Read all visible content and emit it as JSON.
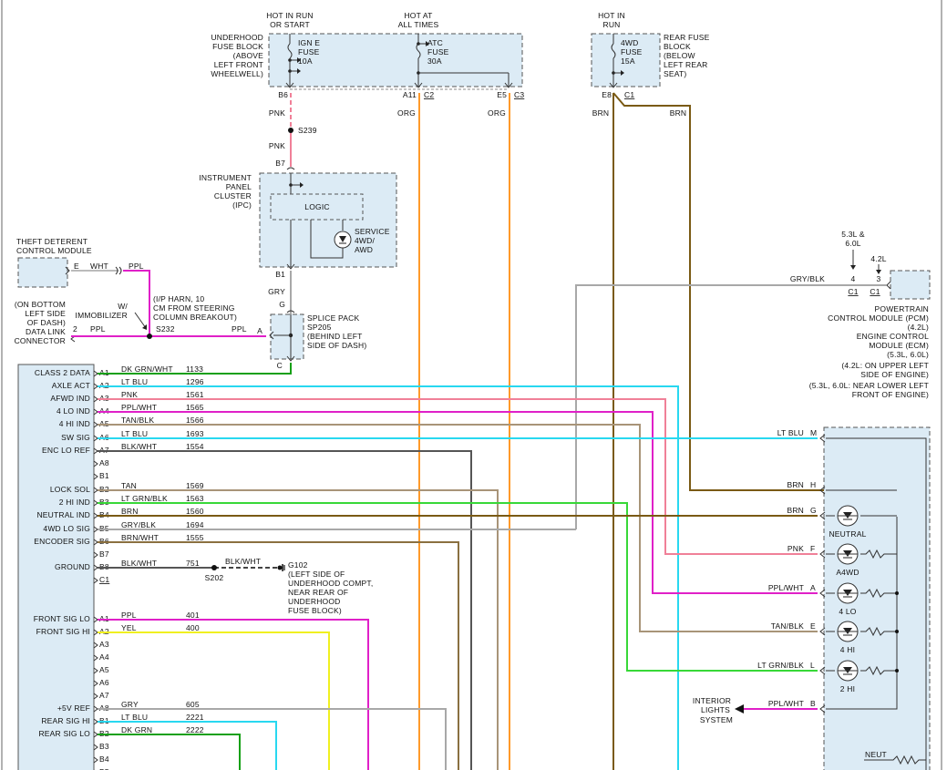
{
  "top": {
    "hot_run_start": [
      "HOT IN RUN",
      "OR START"
    ],
    "hot_all_times": [
      "HOT AT",
      "ALL TIMES"
    ],
    "hot_run": [
      "HOT IN",
      "RUN"
    ]
  },
  "underhood": {
    "label": [
      "UNDERHOOD",
      "FUSE BLOCK",
      "(ABOVE",
      "LEFT FRONT",
      "WHEELWELL)"
    ],
    "fuse1": [
      "IGN E",
      "FUSE",
      "10A"
    ],
    "fuse2": [
      "ATC",
      "FUSE",
      "30A"
    ],
    "pin_b6": "B6",
    "pin_a11": "A11",
    "pin_e5": "E5",
    "conn_c2": "C2",
    "conn_c3": "C3"
  },
  "rear_fuse": {
    "label": [
      "REAR FUSE",
      "BLOCK",
      "(BELOW",
      "LEFT REAR",
      "SEAT)"
    ],
    "fuse": [
      "4WD",
      "FUSE",
      "15A"
    ],
    "pin_e8": "E8",
    "conn_c1": "C1"
  },
  "wires": {
    "pnk1": "PNK",
    "pnk2": "PNK",
    "s239": "S239",
    "b7": "B7",
    "org1": "ORG",
    "org2": "ORG",
    "brn1": "BRN",
    "brn2": "BRN",
    "b1": "B1",
    "gry": "GRY",
    "g": "G",
    "c": "C",
    "a": "A"
  },
  "ipc": {
    "label": [
      "INSTRUMENT",
      "PANEL",
      "CLUSTER",
      "(IPC)"
    ],
    "logic": "LOGIC",
    "service": [
      "SERVICE",
      "4WD/",
      "AWD"
    ]
  },
  "theft": {
    "label": [
      "THEFT DETERENT",
      "CONTROL MODULE"
    ],
    "e": "E",
    "wht": "WHT",
    "ppl": "PPL"
  },
  "dlc": {
    "label": [
      "(ON BOTTOM",
      "LEFT SIDE",
      "OF DASH)",
      "DATA LINK",
      "CONNECTOR"
    ],
    "pin": "2",
    "wire": "PPL"
  },
  "immobilizer": {
    "label": [
      "W/",
      "IMMOBILIZER"
    ]
  },
  "ip_harn": [
    "(I/P HARN, 10",
    "CM FROM STEERING",
    "COLUMN BREAKOUT)"
  ],
  "s232": "S232",
  "ppl_s232": "PPL",
  "splice": {
    "label": [
      "SPLICE PACK",
      "SP205",
      "(BEHIND LEFT",
      "SIDE OF DASH)"
    ]
  },
  "pcm": {
    "variant_a": [
      "5.3L &",
      "6.0L"
    ],
    "variant_b": "4.2L",
    "pin4": "4",
    "pin3": "3",
    "c1a": "C1",
    "c1b": "C1",
    "gry_blk": "GRY/BLK",
    "label": [
      "POWERTRAIN",
      "CONTROL MODULE (PCM)",
      "(4.2L)",
      "ENGINE CONTROL",
      "MODULE (ECM)",
      "(5.3L, 6.0L)",
      "(4.2L: ON UPPER LEFT",
      "SIDE OF ENGINE)",
      "(5.3L, 6.0L: NEAR LOWER LEFT",
      "FRONT OF ENGINE)"
    ]
  },
  "tccm": {
    "rows": [
      {
        "pin": "A1",
        "wire": "DK GRN/WHT",
        "circuit": "1133",
        "label": "CLASS 2 DATA"
      },
      {
        "pin": "A2",
        "wire": "LT BLU",
        "circuit": "1296",
        "label": "AXLE ACT"
      },
      {
        "pin": "A3",
        "wire": "PNK",
        "circuit": "1561",
        "label": "AFWD IND"
      },
      {
        "pin": "A4",
        "wire": "PPL/WHT",
        "circuit": "1565",
        "label": "4 LO IND"
      },
      {
        "pin": "A5",
        "wire": "TAN/BLK",
        "circuit": "1566",
        "label": "4 HI IND"
      },
      {
        "pin": "A6",
        "wire": "LT BLU",
        "circuit": "1693",
        "label": "SW SIG"
      },
      {
        "pin": "A7",
        "wire": "BLK/WHT",
        "circuit": "1554",
        "label": "ENC LO REF"
      },
      {
        "pin": "A8",
        "wire": "",
        "circuit": "",
        "label": ""
      },
      {
        "pin": "B1",
        "wire": "",
        "circuit": "",
        "label": ""
      },
      {
        "pin": "B2",
        "wire": "TAN",
        "circuit": "1569",
        "label": "LOCK SOL"
      },
      {
        "pin": "B3",
        "wire": "LT GRN/BLK",
        "circuit": "1563",
        "label": "2 HI IND"
      },
      {
        "pin": "B4",
        "wire": "BRN",
        "circuit": "1560",
        "label": "NEUTRAL IND"
      },
      {
        "pin": "B5",
        "wire": "GRY/BLK",
        "circuit": "1694",
        "label": "4WD LO SIG"
      },
      {
        "pin": "B6",
        "wire": "BRN/WHT",
        "circuit": "1555",
        "label": "ENCODER SIG"
      },
      {
        "pin": "B7",
        "wire": "",
        "circuit": "",
        "label": ""
      },
      {
        "pin": "B8",
        "wire": "BLK/WHT",
        "circuit": "751",
        "label": ""
      },
      {
        "pin": "C1",
        "wire": "",
        "circuit": "",
        "label": ""
      },
      {
        "pin": "A1",
        "wire": "PPL",
        "circuit": "401",
        "label": ""
      },
      {
        "pin": "A2",
        "wire": "YEL",
        "circuit": "400",
        "label": ""
      },
      {
        "pin": "A3",
        "wire": "",
        "circuit": "",
        "label": ""
      },
      {
        "pin": "A4",
        "wire": "",
        "circuit": "",
        "label": ""
      },
      {
        "pin": "A5",
        "wire": "",
        "circuit": "",
        "label": ""
      },
      {
        "pin": "A6",
        "wire": "",
        "circuit": "",
        "label": ""
      },
      {
        "pin": "A7",
        "wire": "",
        "circuit": "",
        "label": ""
      },
      {
        "pin": "A8",
        "wire": "GRY",
        "circuit": "605",
        "label": ""
      },
      {
        "pin": "B1",
        "wire": "LT BLU",
        "circuit": "2221",
        "label": ""
      },
      {
        "pin": "B2",
        "wire": "DK GRN",
        "circuit": "2222",
        "label": ""
      },
      {
        "pin": "B3",
        "wire": "",
        "circuit": "",
        "label": ""
      },
      {
        "pin": "B4",
        "wire": "",
        "circuit": "",
        "label": ""
      },
      {
        "pin": "B5",
        "wire": "",
        "circuit": "",
        "label": ""
      }
    ],
    "ground_label": "GROUND",
    "front_sig_lo": "FRONT SIG LO",
    "front_sig_hi": "FRONT SIG HI",
    "ref_5v": "+5V REF",
    "rear_sig_hi": "REAR SIG HI",
    "rear_sig_lo": "REAR SIG LO",
    "s202": "S202",
    "blk_wht": "BLK/WHT",
    "g102": "G102",
    "g102_note": [
      "(LEFT SIDE OF",
      "UNDERHOOD COMPT,",
      "NEAR REAR OF",
      "UNDERHOOD",
      "FUSE BLOCK)"
    ]
  },
  "switch": {
    "rows": [
      {
        "wire": "LT BLU",
        "pin": "M"
      },
      {
        "wire": "BRN",
        "pin": "H"
      },
      {
        "wire": "BRN",
        "pin": "G"
      },
      {
        "wire": "PNK",
        "pin": "F"
      },
      {
        "wire": "PPL/WHT",
        "pin": "A"
      },
      {
        "wire": "TAN/BLK",
        "pin": "E"
      },
      {
        "wire": "LT GRN/BLK",
        "pin": "L"
      },
      {
        "wire": "PPL/WHT",
        "pin": "B"
      }
    ],
    "leds": [
      "NEUTRAL",
      "A4WD",
      "4 LO",
      "4 HI",
      "2 HI"
    ],
    "neut": "NEUT",
    "interior": [
      "INTERIOR",
      "LIGHTS",
      "SYSTEM"
    ]
  },
  "colors": {
    "pnk": "#f08098",
    "org": "#ff9a2a",
    "brn": "#7a5a14",
    "gry": "#a8a8a8",
    "ppl": "#e020c8",
    "ltblu": "#28d8f0",
    "dkgrn": "#16a016",
    "tan": "#a89478",
    "ltgrn": "#38d838",
    "yel": "#f0f020",
    "blk": "#555555"
  }
}
